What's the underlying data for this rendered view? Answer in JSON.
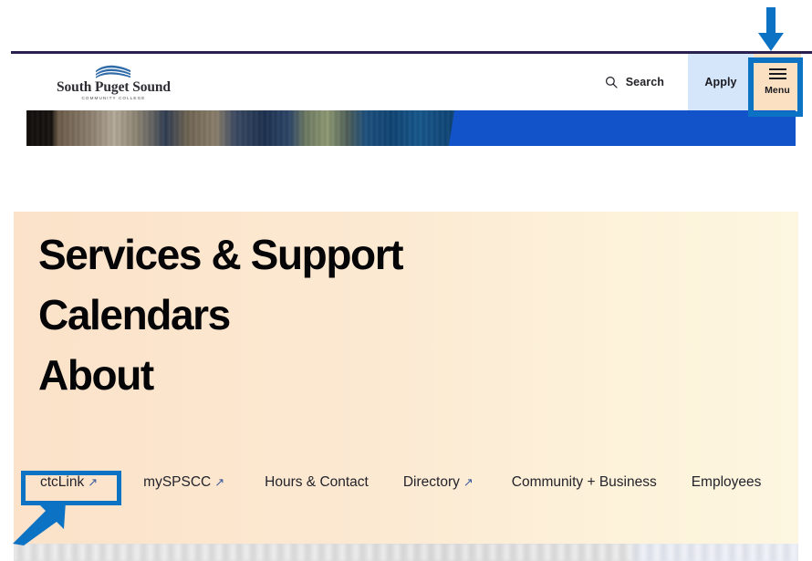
{
  "site": {
    "logo": {
      "icon": "wave-logo-icon",
      "name": "South Puget Sound",
      "subtitle": "COMMUNITY COLLEGE"
    }
  },
  "header": {
    "search": {
      "icon": "search-icon",
      "label": "Search"
    },
    "apply": {
      "label": "Apply",
      "bg_color": "#d6e6fa"
    },
    "menu": {
      "icon": "hamburger-icon",
      "label": "Menu",
      "bg_color": "#fbe0c2"
    }
  },
  "hero": {
    "alt": "campus-building-photo",
    "accent_color": "#1253c9"
  },
  "menu_overlay": {
    "bg_start_color": "#fbe2c9",
    "bg_end_color": "#fdf6e0",
    "primary_links": [
      {
        "label": "Services & Support"
      },
      {
        "label": "Calendars"
      },
      {
        "label": "About"
      }
    ],
    "utility_links": [
      {
        "label": "ctcLink",
        "external": true,
        "external_glyph": "↗"
      },
      {
        "label": "mySPSCC",
        "external": true,
        "external_glyph": "↗"
      },
      {
        "label": "Hours & Contact",
        "external": false,
        "external_glyph": ""
      },
      {
        "label": "Directory",
        "external": true,
        "external_glyph": "↗"
      },
      {
        "label": "Community + Business",
        "external": false,
        "external_glyph": ""
      },
      {
        "label": "Employees",
        "external": false,
        "external_glyph": ""
      }
    ]
  },
  "annotations": {
    "color": "#0b72c4",
    "menu_button_highlight": "Menu button highlighted",
    "ctclink_highlight": "ctcLink link highlighted",
    "down_arrow": "arrow pointing down to Menu button",
    "diagonal_arrow": "arrow pointing up-right to ctcLink"
  }
}
